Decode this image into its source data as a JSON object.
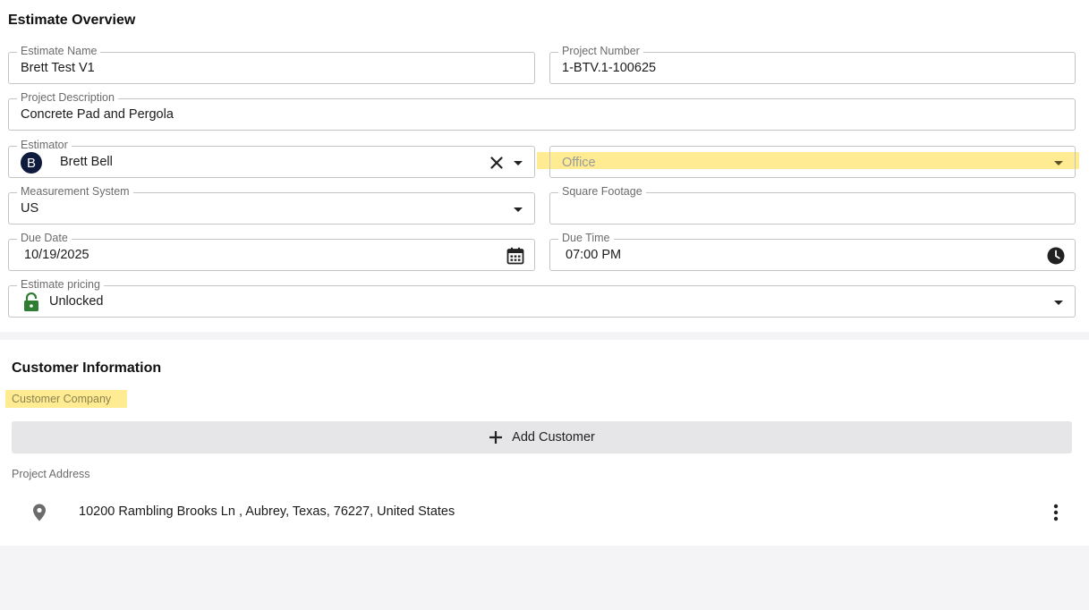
{
  "overview": {
    "title": "Estimate Overview",
    "estimate_name": {
      "label": "Estimate Name",
      "value": "Brett Test V1"
    },
    "project_number": {
      "label": "Project Number",
      "value": "1-BTV.1-100625"
    },
    "project_description": {
      "label": "Project Description",
      "value": "Concrete Pad and Pergola"
    },
    "estimator": {
      "label": "Estimator",
      "value": "Brett Bell",
      "avatar_initial": "B",
      "icons": [
        "clear-icon",
        "chevron-down-icon"
      ]
    },
    "office": {
      "placeholder": "Office",
      "icon": "chevron-down-icon"
    },
    "measurement_system": {
      "label": "Measurement System",
      "value": "US",
      "icon": "chevron-down-icon"
    },
    "square_footage": {
      "label": "Square Footage",
      "value": ""
    },
    "due_date": {
      "label": "Due Date",
      "value": "10/19/2025",
      "icon": "calendar-icon"
    },
    "due_time": {
      "label": "Due Time",
      "value": "07:00 PM",
      "icon": "clock-icon"
    },
    "estimate_pricing": {
      "label": "Estimate pricing",
      "value": "Unlocked",
      "icon": "unlocked-icon",
      "icon_color": "#2e7d32"
    }
  },
  "customer": {
    "title": "Customer Information",
    "company_label": "Customer Company",
    "add_button": "Add Customer",
    "address_label": "Project Address",
    "address": "10200 Rambling Brooks Ln , Aubrey, Texas, 76227, United States",
    "icons": [
      "map-pin-icon",
      "more-vert-icon",
      "plus-icon"
    ]
  },
  "colors": {
    "highlight": "#fde98a",
    "page_bg": "#f4f4f6",
    "avatar_bg": "#0f1b3d"
  }
}
